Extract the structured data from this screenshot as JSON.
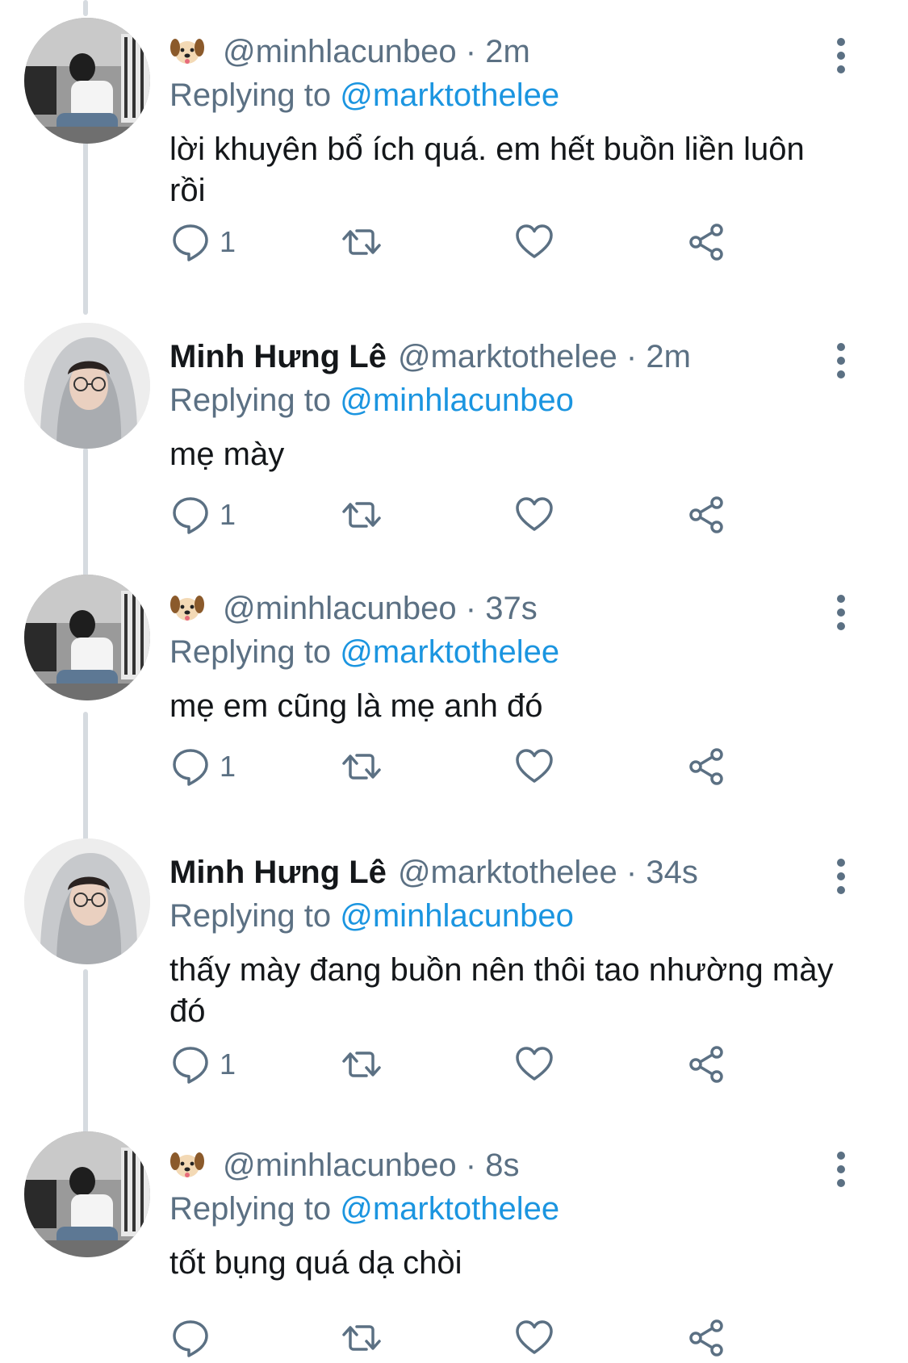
{
  "tweets": [
    {
      "emoji": "dog-face-emoji",
      "display_name": "",
      "handle": "@minhlacunbeo",
      "time": "· 2m",
      "replying_label": "Replying to",
      "replying_to": "@marktothelee",
      "text": "lời khuyên bổ ích quá. em hết buồn liền luôn rồi",
      "reply_count": "1"
    },
    {
      "display_name": "Minh Hưng Lê",
      "handle": "@marktothelee",
      "time": "· 2m",
      "replying_label": "Replying to",
      "replying_to": "@minhlacunbeo",
      "text": "mẹ mày",
      "reply_count": "1"
    },
    {
      "emoji": "dog-face-emoji",
      "display_name": "",
      "handle": "@minhlacunbeo",
      "time": "· 37s",
      "replying_label": "Replying to",
      "replying_to": "@marktothelee",
      "text": "mẹ em cũng là mẹ anh đó",
      "reply_count": "1"
    },
    {
      "display_name": "Minh Hưng Lê",
      "handle": "@marktothelee",
      "time": "· 34s",
      "replying_label": "Replying to",
      "replying_to": "@minhlacunbeo",
      "text": "thấy mày đang buồn nên thôi tao nhường mày đó",
      "reply_count": "1"
    },
    {
      "emoji": "dog-face-emoji",
      "display_name": "",
      "handle": "@minhlacunbeo",
      "time": "· 8s",
      "replying_label": "Replying to",
      "replying_to": "@marktothelee",
      "text": "tốt bụng quá dạ chòi",
      "reply_count": ""
    }
  ],
  "icons": {
    "reply": "reply-icon",
    "retweet": "retweet-icon",
    "like": "heart-icon",
    "share": "share-icon",
    "more": "more-vertical-icon"
  },
  "colors": {
    "text_primary": "#14171a",
    "text_secondary": "#5b7083",
    "mention": "#1b95e0",
    "thread_line": "#d6dbe0"
  }
}
